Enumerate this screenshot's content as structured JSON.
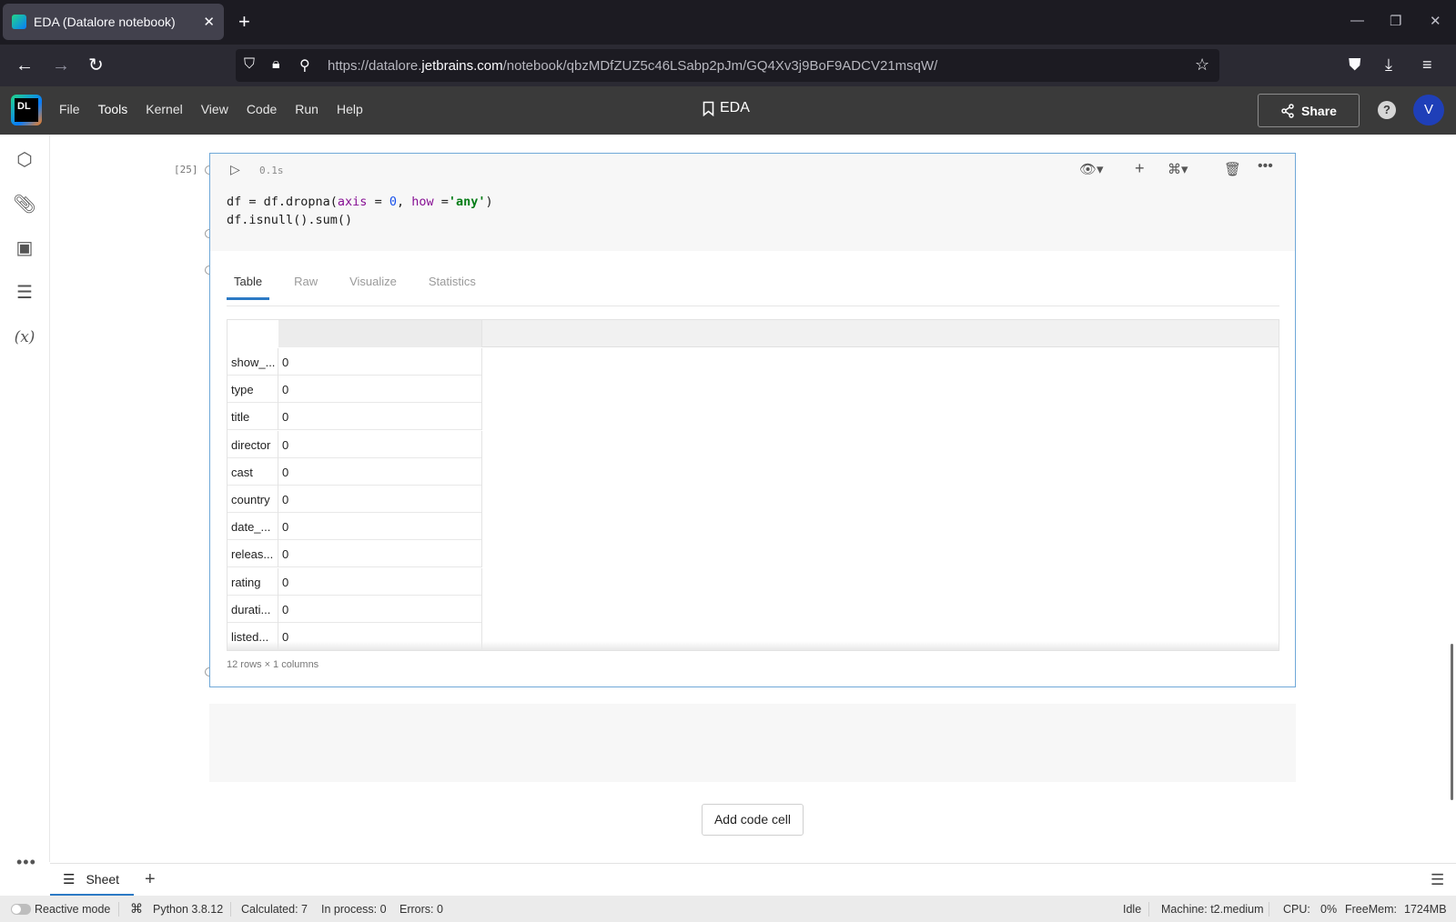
{
  "browser": {
    "tab_title": "EDA (Datalore notebook)",
    "tab_close": "✕",
    "new_tab": "+",
    "url_host_prefix": "https://datalore.",
    "url_host_main": "jetbrains.com",
    "url_path": "/notebook/qbzMDfZUZ5c46LSabp2pJm/GQ4Xv3j9BoF9ADCV21msqW/"
  },
  "app": {
    "logo_text": "DL",
    "menu": [
      "File",
      "Tools",
      "Kernel",
      "View",
      "Code",
      "Run",
      "Help"
    ],
    "doc_title": "EDA",
    "share_label": "Share",
    "help_label": "?",
    "avatar_letter": "V",
    "accent_color": "#2c7ac5"
  },
  "cell": {
    "exec_count": "[25]",
    "exec_time": "0.1s",
    "code": {
      "line1": {
        "a": "df = df.dropna(",
        "b": "axis",
        "c": " = ",
        "d": "0",
        "e": ", ",
        "f": "how",
        "g": " =",
        "h": "'any'",
        "i": ")"
      },
      "line2": "df.isnull().sum()"
    },
    "output_tabs": [
      "Table",
      "Raw",
      "Visualize",
      "Statistics"
    ],
    "table": {
      "rows": [
        {
          "index": "show_...",
          "value": "0"
        },
        {
          "index": "type",
          "value": "0"
        },
        {
          "index": "title",
          "value": "0"
        },
        {
          "index": "director",
          "value": "0"
        },
        {
          "index": "cast",
          "value": "0"
        },
        {
          "index": "country",
          "value": "0"
        },
        {
          "index": "date_...",
          "value": "0"
        },
        {
          "index": "releas...",
          "value": "0"
        },
        {
          "index": "rating",
          "value": "0"
        },
        {
          "index": "durati...",
          "value": "0"
        },
        {
          "index": "listed...",
          "value": "0"
        }
      ],
      "summary": "12 rows × 1 columns"
    }
  },
  "add_code_cell_label": "Add code cell",
  "sheet": {
    "tab_label": "Sheet",
    "add_label": "+"
  },
  "status": {
    "reactive_mode": "Reactive mode",
    "python": "Python 3.8.12",
    "calculated": "Calculated: 7",
    "in_process": "In process: 0",
    "errors": "Errors: 0",
    "idle": "Idle",
    "machine": "Machine: t2.medium",
    "cpu_label": "CPU:",
    "cpu_value": "0%",
    "freemem_label": "FreeMem:",
    "freemem_value": "1724MB"
  }
}
